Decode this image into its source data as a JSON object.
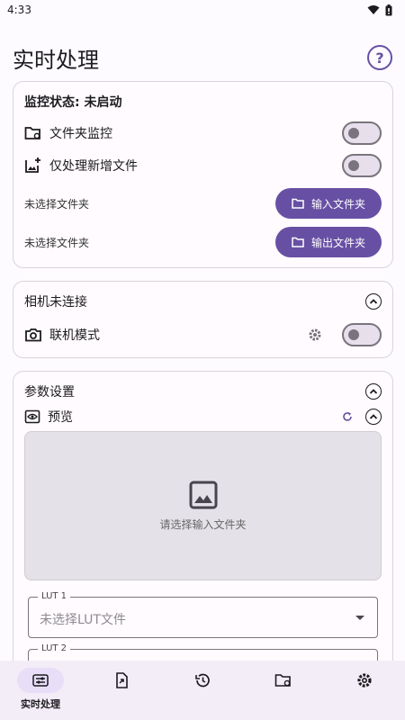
{
  "status_bar": {
    "time": "4:33"
  },
  "header": {
    "title": "实时处理"
  },
  "monitor_card": {
    "status": "监控状态: 未启动",
    "folder_monitor_label": "文件夹监控",
    "folder_monitor_on": false,
    "new_only_label": "仅处理新增文件",
    "new_only_on": false,
    "input_folder_text": "未选择文件夹",
    "input_folder_button": "输入文件夹",
    "output_folder_text": "未选择文件夹",
    "output_folder_button": "输出文件夹"
  },
  "camera_card": {
    "title": "相机未连接",
    "tether_label": "联机模式",
    "tether_on": false
  },
  "params_card": {
    "title": "参数设置",
    "preview_label": "预览",
    "preview_placeholder": "请选择输入文件夹",
    "lut1_label": "LUT 1",
    "lut1_value": "未选择LUT文件",
    "lut2_label": "LUT 2"
  },
  "bottom_nav": {
    "items": [
      {
        "label": "实时处理",
        "active": true
      },
      {
        "label": "",
        "active": false
      },
      {
        "label": "",
        "active": false
      },
      {
        "label": "",
        "active": false
      },
      {
        "label": "",
        "active": false
      }
    ]
  },
  "colors": {
    "primary": "#6750a4",
    "nav_bg": "#f3edf7",
    "preview_bg": "#e5e1e8"
  }
}
